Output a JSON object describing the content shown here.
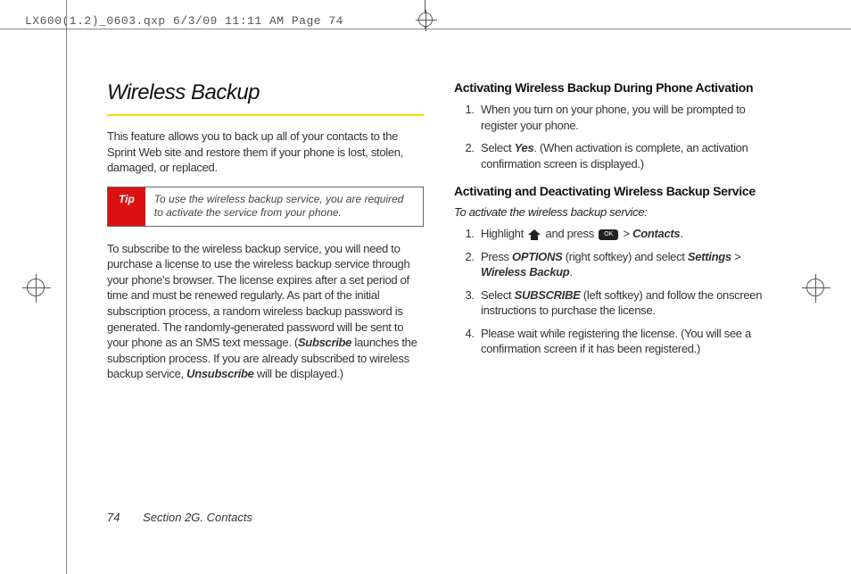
{
  "header_slug": "LX600(1.2)_0603.qxp  6/3/09  11:11 AM  Page 74",
  "left": {
    "title": "Wireless Backup",
    "intro": "This feature allows you to back up all of your contacts to the Sprint Web site and restore them if your phone is lost, stolen, damaged, or replaced.",
    "tip_label": "Tip",
    "tip_text": "To use the wireless backup service, you are required to activate the service from your phone.",
    "para2a": "To subscribe to the wireless backup service, you will need to purchase a license to use the wireless backup service through your phone's browser. The license expires after a set period of time and must be renewed regularly. As part of the initial subscription process, a random wireless backup password is generated. The randomly-generated password will be sent to your phone as an SMS text message. (",
    "para2_sub": "Subscribe",
    "para2b": " launches the subscription process. If you are already subscribed to wireless backup service, ",
    "para2_unsub": "Unsubscribe",
    "para2c": " will be displayed.)"
  },
  "right": {
    "h1": "Activating Wireless Backup During Phone Activation",
    "steps1": {
      "s1": "When you turn on your phone, you will be prompted to register your phone.",
      "s2a": "Select ",
      "s2_yes": "Yes",
      "s2b": ". (When activation is complete, an activation confirmation screen is displayed.)"
    },
    "h2": "Activating and Deactivating Wireless Backup Service",
    "sub": "To activate the wireless backup service:",
    "steps2": {
      "s1a": "Highlight ",
      "s1b": " and press ",
      "s1_ok": "MENU OK",
      "s1c": " > ",
      "s1_contacts": "Contacts",
      "s1d": ".",
      "s2a": "Press ",
      "s2_options": "OPTIONS",
      "s2b": " (right softkey) and select ",
      "s2_settings": "Settings",
      "s2c": " > ",
      "s2_wb": "Wireless Backup",
      "s2d": ".",
      "s3a": "Select ",
      "s3_sub": "SUBSCRIBE",
      "s3b": " (left softkey) and follow the onscreen instructions to purchase the license.",
      "s4": "Please wait while registering the license. (You will see a confirmation screen if it has been registered.)"
    }
  },
  "footer": {
    "page": "74",
    "section": "Section 2G. Contacts"
  }
}
